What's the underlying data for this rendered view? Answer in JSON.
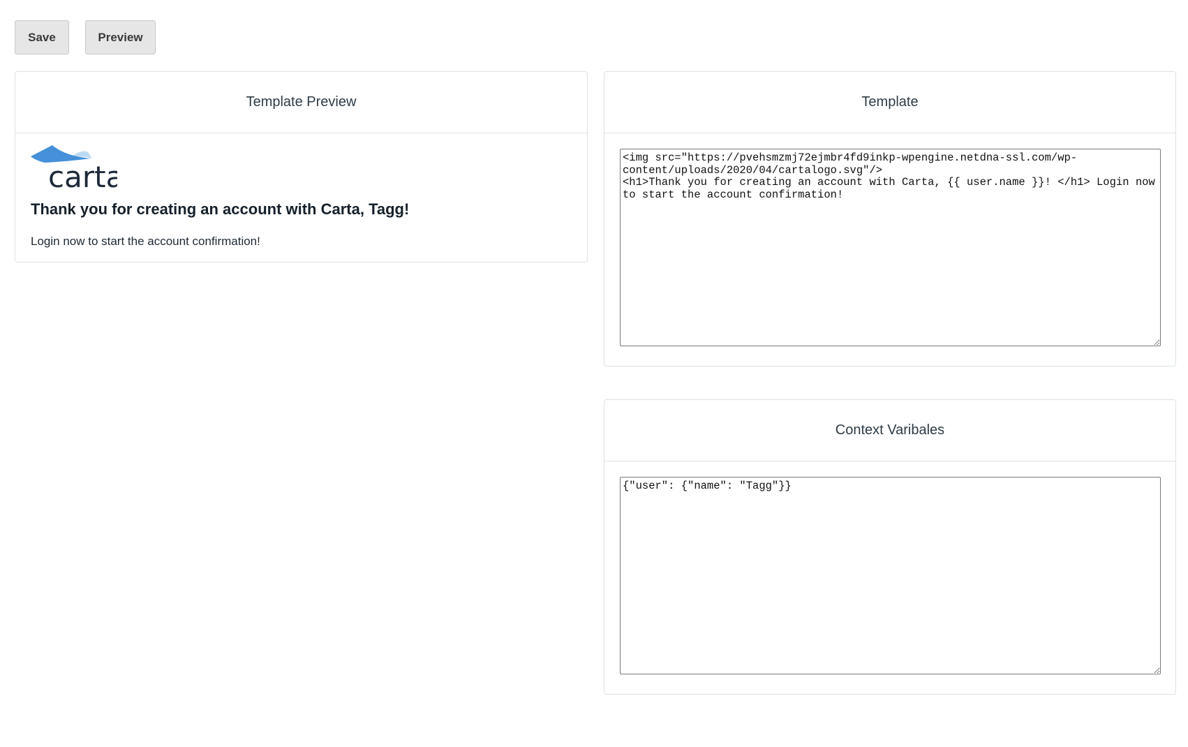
{
  "toolbar": {
    "save_label": "Save",
    "preview_label": "Preview"
  },
  "preview": {
    "title": "Template Preview",
    "logo_text": "carta",
    "heading": "Thank you for creating an account with Carta, Tagg!",
    "body": "Login now to start the account confirmation!"
  },
  "template": {
    "title": "Template",
    "value": "<img src=\"https://pvehsmzmj72ejmbr4fd9inkp-wpengine.netdna-ssl.com/wp-content/uploads/2020/04/cartalogo.svg\"/>\n<h1>Thank you for creating an account with Carta, {{ user.name }}! </h1> Login now to start the account confirmation!"
  },
  "context": {
    "title": "Context Varibales",
    "value": "{\"user\": {\"name\": \"Tagg\"}}"
  },
  "colors": {
    "logo_blue": "#4590d9",
    "logo_light_blue": "#bcdaf1",
    "logo_text": "#1e2a3b"
  }
}
